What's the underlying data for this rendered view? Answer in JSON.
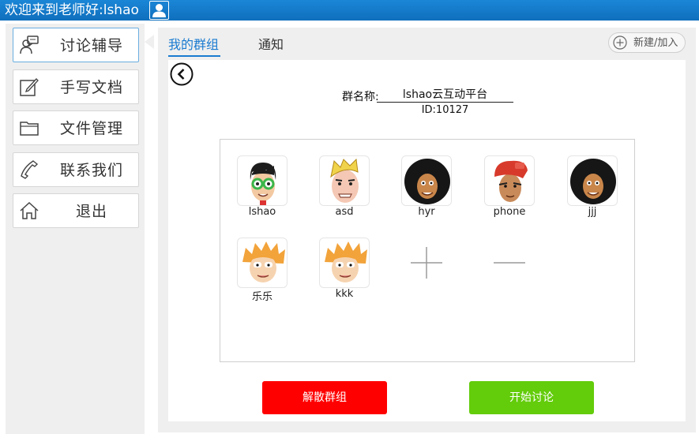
{
  "header": {
    "title": "欢迎来到老师好:lshao",
    "user_icon": "person-icon"
  },
  "sidebar": {
    "items": [
      {
        "label": "讨论辅导",
        "icon": "discussion-icon",
        "active": true
      },
      {
        "label": "手写文档",
        "icon": "pen-edit-icon"
      },
      {
        "label": "文件管理",
        "icon": "folder-icon"
      },
      {
        "label": "联系我们",
        "icon": "phone-icon"
      },
      {
        "label": "退出",
        "icon": "home-icon"
      }
    ]
  },
  "tabs": [
    {
      "label": "我的群组",
      "active": true
    },
    {
      "label": "通知",
      "active": false
    }
  ],
  "new_join": {
    "label": "新建/加入",
    "icon": "plus-circle-icon"
  },
  "group": {
    "name_label": "群名称:",
    "name_value": "lshao云互动平台",
    "id_text": "ID:10127"
  },
  "members": [
    {
      "name": "lshao",
      "avatar": "glasses-guy-avatar"
    },
    {
      "name": "asd",
      "avatar": "blond-guy-avatar"
    },
    {
      "name": "hyr",
      "avatar": "afro-guy-avatar"
    },
    {
      "name": "phone",
      "avatar": "red-cap-guy-avatar"
    },
    {
      "name": "jjj",
      "avatar": "afro-guy-avatar"
    },
    {
      "name": "乐乐",
      "avatar": "orange-hair-guy-avatar"
    },
    {
      "name": "kkk",
      "avatar": "orange-hair-guy-avatar"
    }
  ],
  "actions": {
    "add_member_icon": "plus-icon",
    "remove_member_icon": "minus-icon",
    "dissolve_label": "解散群组",
    "start_label": "开始讨论"
  },
  "colors": {
    "accent": "#1a7bd0",
    "danger": "#ff0000",
    "success": "#63cc0b",
    "titlebar": "#1279c8"
  }
}
